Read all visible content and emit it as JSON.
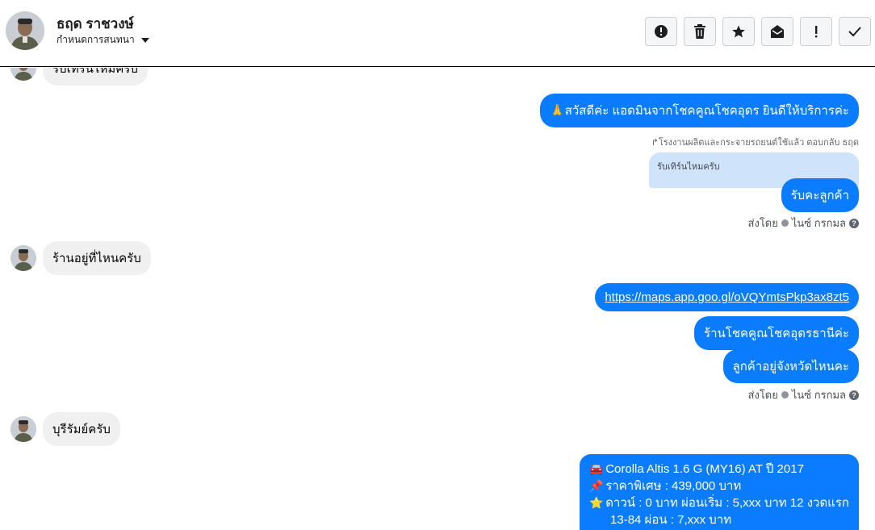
{
  "header": {
    "name": "ธฤด ราชวงษ์",
    "assign_label": "กำหนดการสนทนา",
    "actions": [
      {
        "icon": "alert-circle-icon",
        "name": "mark-spam-button"
      },
      {
        "icon": "trash-icon",
        "name": "delete-button"
      },
      {
        "icon": "star-icon",
        "name": "star-button"
      },
      {
        "icon": "mark-unread-icon",
        "name": "mark-unread-button"
      },
      {
        "icon": "exclamation-icon",
        "name": "follow-up-button"
      },
      {
        "icon": "check-icon",
        "name": "mark-done-button"
      }
    ]
  },
  "messages": {
    "top_partial": "รับเทิร์นไหมครับ",
    "admin_greeting": "🙏สวัสดีค่ะ แอดมินจากโชคคูณโชคอุดร ยินดีให้บริการค่ะ",
    "reply_label": "↱โรงงานผลิตและกระจายรถยนต์ใช้แล้ว ตอบกลับ ธฤด",
    "reply_quote": "รับเทิร์นไหมครับ",
    "reply_answer": "รับคะลูกค้า",
    "sent_by_1": "ส่งโดย",
    "sender_1": "ไนซ์ กรกมล",
    "customer_q1": "ร้านอยู่ที่ไหนครับ",
    "map_link": "https://maps.app.goo.gl/oVQYmtsPkp3ax8zt5",
    "shop_name": "ร้านโชคคูณโชคอุดรธานีค่ะ",
    "ask_province": "ลูกค้าอยู่จังหวัดไหนคะ",
    "sent_by_2": "ส่งโดย",
    "sender_2": "ไนซ์ กรกมล",
    "customer_q2": "บุรีรัมย์ครับ",
    "car_offer": {
      "line1": "Corolla Altis 1.6 G (MY16) AT ปี 2017",
      "line2": "ราคาพิเศษ : 439,000 บาท",
      "line3": "ดาวน์ : 0 บาท ผ่อนเริ่ม : 5,xxx บาท 12 งวดแรก",
      "line4": "13-84 ผ่อน : 7,xxx บาท"
    }
  },
  "colors": {
    "outgoing_bubble": "#0a7cff",
    "incoming_bubble": "#f0f0f0",
    "reply_quote_bg": "#cfe3fb"
  }
}
